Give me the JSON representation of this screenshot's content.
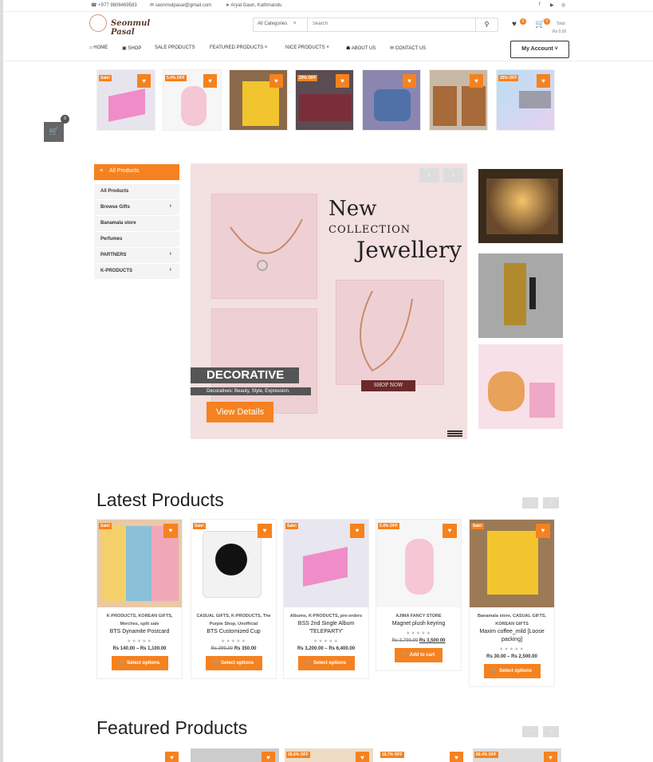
{
  "topbar": {
    "phone": "+977 9808469583",
    "email": "seonmulpasal@gmail.com",
    "location": "Aryal Gaun, Kathmandu",
    "social": [
      "f",
      "▶",
      "◎"
    ]
  },
  "header": {
    "logo_text": "Seonmul Pasal",
    "search": {
      "category": "All Categories",
      "placeholder": "Search"
    },
    "wishlist_count": "0",
    "cart_count": "0",
    "total_label": "Total",
    "total_value": "Rs 0.00"
  },
  "nav": {
    "items": [
      {
        "label": "HOME",
        "icon": "home-icon"
      },
      {
        "label": "SHOP",
        "icon": "shop-icon"
      },
      {
        "label": "SALE PRODUCTS"
      },
      {
        "label": "FEATURED PRODUCTS ˅"
      },
      {
        "label": "NICE PRODUCTS ˅"
      },
      {
        "label": "ABOUT US",
        "icon": "people-icon"
      },
      {
        "label": "CONTACT US",
        "icon": "envelope-icon"
      }
    ],
    "account": "My Account ˅"
  },
  "strip": [
    {
      "badge": "Sale!"
    },
    {
      "badge": "5.4% OFF"
    },
    {
      "badge": ""
    },
    {
      "badge": "20% OFF"
    },
    {
      "badge": ""
    },
    {
      "badge": ""
    },
    {
      "badge": "25% OFF"
    }
  ],
  "floating_cart": {
    "count": "0"
  },
  "categories": {
    "title": "All Products",
    "items": [
      {
        "label": "All Products",
        "arrow": ""
      },
      {
        "label": "Browse Gifts",
        "arrow": "›"
      },
      {
        "label": "Banamala store",
        "arrow": ""
      },
      {
        "label": "Perfumes",
        "arrow": ""
      },
      {
        "label": "PARTNERS",
        "arrow": "›"
      },
      {
        "label": "K-PRODUCTS",
        "arrow": "›"
      }
    ]
  },
  "hero": {
    "new": "New",
    "collection": "COLLECTION",
    "jewellery": "Jewellery",
    "shop_now": "SHOP NOW",
    "caption_title": "DECORATIVE",
    "caption_sub": "Decoratives: Beauty, Style, Expression.",
    "cta": "View Details",
    "prev": "‹",
    "next": "›"
  },
  "latest": {
    "title": "Latest Products",
    "prev": "‹",
    "next": "›",
    "products": [
      {
        "badge": "Sale!",
        "cats": "K-PRODUCTS, KOREAN GIFTS, Merches, split sale",
        "name": "BTS Dynamite Postcard",
        "price_old": "",
        "price": "Rs 140.00 – Rs 1,100.00",
        "button": "Select options"
      },
      {
        "badge": "Sale!",
        "cats": "CASUAL GIFTS, K-PRODUCTS, The Purple Shop, Unofficial",
        "name": "BTS Customized Cup",
        "price_old": "Rs 390.00",
        "price": "Rs 350.00",
        "button": "Select options"
      },
      {
        "badge": "Sale!",
        "cats": "Albums, K-PRODUCTS, pre-orders",
        "name": "BSS 2nd Single Album 'TELEPARTY'",
        "price_old": "",
        "price": "Rs 3,200.00 – Rs 6,400.00",
        "button": "Select options"
      },
      {
        "badge": "5.4% OFF",
        "cats": "AJIMA FANCY STORE",
        "name": "Magnet plush keyring",
        "price_old": "Rs 3,700.00",
        "price": "Rs 3,500.00",
        "button": "Add to cart"
      },
      {
        "badge": "Sale!",
        "cats": "Banamala store, CASUAL GIFTS, KOREAN GIFTS",
        "name": "Maxim coffee_mild [Loose packing]",
        "price_old": "",
        "price": "Rs 30.00 – Rs 2,500.00",
        "button": "Select options"
      }
    ]
  },
  "featured": {
    "title": "Featured Products",
    "prev": "‹",
    "next": "›",
    "badges": [
      "",
      "",
      "28.6% OFF",
      "16.7% OFF",
      "89.4% OFF"
    ]
  },
  "stars": "★★★★★",
  "colors": {
    "accent": "#f5821f"
  }
}
